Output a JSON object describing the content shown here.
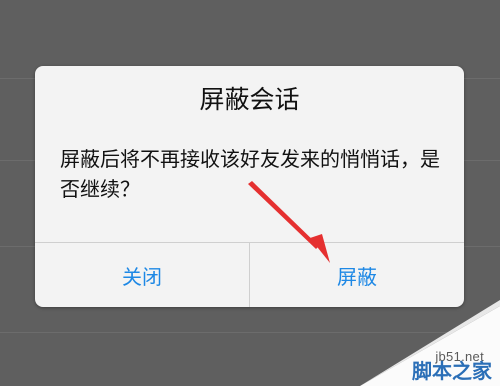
{
  "dialog": {
    "title": "屏蔽会话",
    "message": "屏蔽后将不再接收该好友发来的悄悄话，是否继续？",
    "buttons": {
      "close_label": "关闭",
      "block_label": "屏蔽"
    }
  },
  "watermark": {
    "url": "jb51.net",
    "site": "脚本之家"
  },
  "colors": {
    "background": "#5f5f5f",
    "dialog": "#f3f3f3",
    "accent": "#1e88e5",
    "arrow": "#e53030"
  }
}
